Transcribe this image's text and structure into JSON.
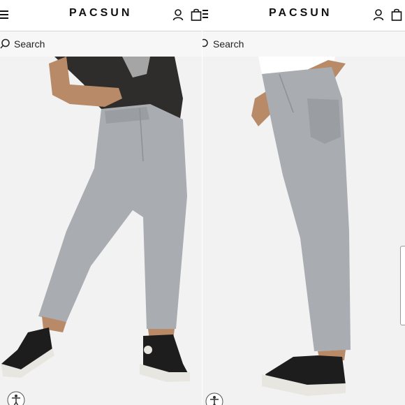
{
  "left_screen": {
    "brand": "PACSUN",
    "search_label": "Search",
    "icons": [
      "menu-icon",
      "account-icon",
      "bag-icon",
      "search-icon",
      "accessibility-icon"
    ]
  },
  "right_screen": {
    "brand": "PACSUN",
    "search_label": "Search",
    "icons": [
      "menu-icon",
      "account-icon",
      "bag-icon",
      "search-icon",
      "accessibility-icon"
    ]
  },
  "colors": {
    "header_bg": "#ffffff",
    "search_bg": "#f7f7f7",
    "photo_bg": "#f2f2f2",
    "denim": "#a9adb1",
    "shirt": "#2f2d2c",
    "sneaker": "#1d1d1d"
  }
}
